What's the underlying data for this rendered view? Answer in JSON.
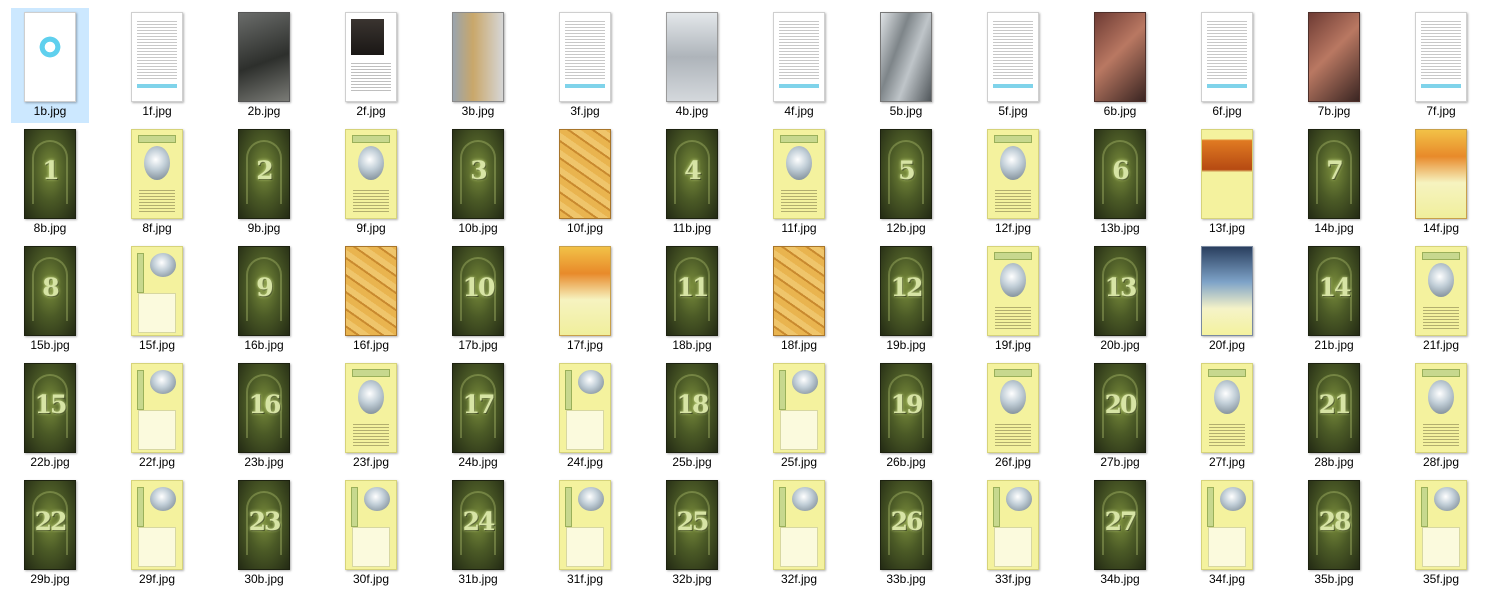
{
  "files": [
    {
      "name": "1b.jpg",
      "kind": "logo"
    },
    {
      "name": "1f.jpg",
      "kind": "rules"
    },
    {
      "name": "2b.jpg",
      "kind": "photo-dark"
    },
    {
      "name": "2f.jpg",
      "kind": "portrait"
    },
    {
      "name": "3b.jpg",
      "kind": "orange"
    },
    {
      "name": "3f.jpg",
      "kind": "rules"
    },
    {
      "name": "4b.jpg",
      "kind": "robot"
    },
    {
      "name": "4f.jpg",
      "kind": "rules"
    },
    {
      "name": "5b.jpg",
      "kind": "corridor"
    },
    {
      "name": "5f.jpg",
      "kind": "rules"
    },
    {
      "name": "6b.jpg",
      "kind": "red"
    },
    {
      "name": "6f.jpg",
      "kind": "rules"
    },
    {
      "name": "7b.jpg",
      "kind": "red"
    },
    {
      "name": "7f.jpg",
      "kind": "rules"
    },
    {
      "name": "8b.jpg",
      "kind": "door",
      "num": "1"
    },
    {
      "name": "8f.jpg",
      "kind": "yellow"
    },
    {
      "name": "9b.jpg",
      "kind": "door",
      "num": "2"
    },
    {
      "name": "9f.jpg",
      "kind": "yellow"
    },
    {
      "name": "10b.jpg",
      "kind": "door",
      "num": "3"
    },
    {
      "name": "10f.jpg",
      "kind": "parchment"
    },
    {
      "name": "11b.jpg",
      "kind": "door",
      "num": "4"
    },
    {
      "name": "11f.jpg",
      "kind": "yellow"
    },
    {
      "name": "12b.jpg",
      "kind": "door",
      "num": "5"
    },
    {
      "name": "12f.jpg",
      "kind": "yellow"
    },
    {
      "name": "13b.jpg",
      "kind": "door",
      "num": "6"
    },
    {
      "name": "13f.jpg",
      "kind": "briefs"
    },
    {
      "name": "14b.jpg",
      "kind": "door",
      "num": "7"
    },
    {
      "name": "14f.jpg",
      "kind": "fire"
    },
    {
      "name": "15b.jpg",
      "kind": "door",
      "num": "8"
    },
    {
      "name": "15f.jpg",
      "kind": "yellow-side"
    },
    {
      "name": "16b.jpg",
      "kind": "door",
      "num": "9"
    },
    {
      "name": "16f.jpg",
      "kind": "parchment"
    },
    {
      "name": "17b.jpg",
      "kind": "door",
      "num": "10"
    },
    {
      "name": "17f.jpg",
      "kind": "fire"
    },
    {
      "name": "18b.jpg",
      "kind": "door",
      "num": "11"
    },
    {
      "name": "18f.jpg",
      "kind": "parchment"
    },
    {
      "name": "19b.jpg",
      "kind": "door",
      "num": "12"
    },
    {
      "name": "19f.jpg",
      "kind": "yellow"
    },
    {
      "name": "20b.jpg",
      "kind": "door",
      "num": "13"
    },
    {
      "name": "20f.jpg",
      "kind": "wizard"
    },
    {
      "name": "21b.jpg",
      "kind": "door",
      "num": "14"
    },
    {
      "name": "21f.jpg",
      "kind": "yellow"
    },
    {
      "name": "22b.jpg",
      "kind": "door",
      "num": "15"
    },
    {
      "name": "22f.jpg",
      "kind": "yellow-side"
    },
    {
      "name": "23b.jpg",
      "kind": "door",
      "num": "16"
    },
    {
      "name": "23f.jpg",
      "kind": "yellow"
    },
    {
      "name": "24b.jpg",
      "kind": "door",
      "num": "17"
    },
    {
      "name": "24f.jpg",
      "kind": "yellow-side"
    },
    {
      "name": "25b.jpg",
      "kind": "door",
      "num": "18"
    },
    {
      "name": "25f.jpg",
      "kind": "yellow-side"
    },
    {
      "name": "26b.jpg",
      "kind": "door",
      "num": "19"
    },
    {
      "name": "26f.jpg",
      "kind": "yellow"
    },
    {
      "name": "27b.jpg",
      "kind": "door",
      "num": "20"
    },
    {
      "name": "27f.jpg",
      "kind": "yellow"
    },
    {
      "name": "28b.jpg",
      "kind": "door",
      "num": "21"
    },
    {
      "name": "28f.jpg",
      "kind": "yellow"
    },
    {
      "name": "29b.jpg",
      "kind": "door",
      "num": "22"
    },
    {
      "name": "29f.jpg",
      "kind": "yellow-side"
    },
    {
      "name": "30b.jpg",
      "kind": "door",
      "num": "23"
    },
    {
      "name": "30f.jpg",
      "kind": "yellow-side"
    },
    {
      "name": "31b.jpg",
      "kind": "door",
      "num": "24"
    },
    {
      "name": "31f.jpg",
      "kind": "yellow-side"
    },
    {
      "name": "32b.jpg",
      "kind": "door",
      "num": "25"
    },
    {
      "name": "32f.jpg",
      "kind": "yellow-side"
    },
    {
      "name": "33b.jpg",
      "kind": "door",
      "num": "26"
    },
    {
      "name": "33f.jpg",
      "kind": "yellow-side"
    },
    {
      "name": "34b.jpg",
      "kind": "door",
      "num": "27"
    },
    {
      "name": "34f.jpg",
      "kind": "yellow-side"
    },
    {
      "name": "35b.jpg",
      "kind": "door",
      "num": "28"
    },
    {
      "name": "35f.jpg",
      "kind": "yellow-side"
    }
  ],
  "selected_file": "1b.jpg",
  "colors": {
    "selection": "#cce8ff",
    "door_glow": "#d7e4a5",
    "card_yellow": "#f4f29e"
  }
}
